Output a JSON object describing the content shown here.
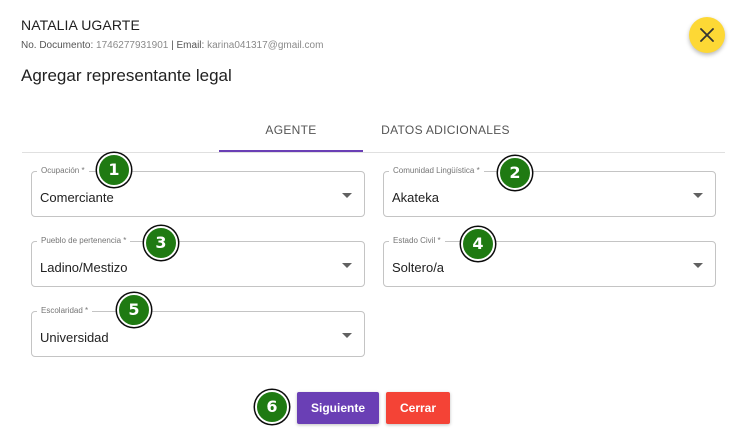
{
  "header": {
    "name": "NATALIA UGARTE",
    "doc_label": "No. Documento: ",
    "doc_value": "1746277931901",
    "separator": " | ",
    "email_label": "Email: ",
    "email_value": "karina041317@gmail.com"
  },
  "dialog": {
    "title": "Agregar representante legal"
  },
  "tabs": [
    {
      "label": "AGENTE",
      "active": true
    },
    {
      "label": "DATOS ADICIONALES",
      "active": false
    }
  ],
  "fields": {
    "ocupacion": {
      "label": "Ocupación *",
      "value": "Comerciante"
    },
    "comunidad": {
      "label": "Comunidad Lingüística *",
      "value": "Akateka"
    },
    "pueblo": {
      "label": "Pueblo de pertenencia *",
      "value": "Ladino/Mestizo"
    },
    "estado_civil": {
      "label": "Estado Civil *",
      "value": "Soltero/a"
    },
    "escolaridad": {
      "label": "Escolaridad *",
      "value": "Universidad"
    }
  },
  "badges": [
    "1",
    "2",
    "3",
    "4",
    "5",
    "6"
  ],
  "buttons": {
    "next_label": "Siguiente",
    "close_label": "Cerrar"
  },
  "icons": {
    "close": "close-icon",
    "dropdown": "chevron-down-icon"
  },
  "colors": {
    "accent": "#6a3fb5",
    "close_fab": "#fdd835",
    "danger": "#f44336",
    "badge": "#1f7a12"
  }
}
